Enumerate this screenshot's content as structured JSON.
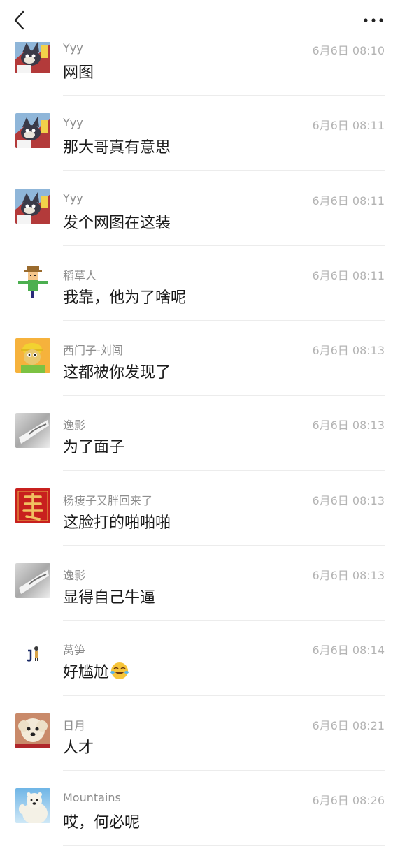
{
  "header": {
    "back_icon": "chevron-left-icon",
    "more_icon": "more-horizontal-icon"
  },
  "messages": [
    {
      "name": "Yyy",
      "time": "6月6日 08:10",
      "text": "网图",
      "avatar": "cat-avatar"
    },
    {
      "name": "Yyy",
      "time": "6月6日 08:11",
      "text": "那大哥真有意思",
      "avatar": "cat-avatar"
    },
    {
      "name": "Yyy",
      "time": "6月6日 08:11",
      "text": "发个网图在这装",
      "avatar": "cat-avatar"
    },
    {
      "name": "稻草人",
      "time": "6月6日 08:11",
      "text": "我靠，他为了啥呢",
      "avatar": "scarecrow-avatar"
    },
    {
      "name": "西门子-刘闯",
      "time": "6月6日 08:13",
      "text": "这都被你发现了",
      "avatar": "worker-avatar"
    },
    {
      "name": "逸影",
      "time": "6月6日 08:13",
      "text": "为了面子",
      "avatar": "hand-photo-avatar"
    },
    {
      "name": "杨瘦子又胖回来了",
      "time": "6月6日 08:13",
      "text": "这脸打的啪啪啪",
      "avatar": "red-seal-avatar"
    },
    {
      "name": "逸影",
      "time": "6月6日 08:13",
      "text": "显得自己牛逼",
      "avatar": "hand-photo-avatar"
    },
    {
      "name": "莴笋",
      "time": "6月6日 08:14",
      "text": "好尴尬",
      "avatar": "small-figure-avatar",
      "emoji": "laugh-cry-emoji"
    },
    {
      "name": "日月",
      "time": "6月6日 08:21",
      "text": "人才",
      "avatar": "dog-avatar"
    },
    {
      "name": "Mountains",
      "time": "6月6日 08:26",
      "text": "哎，何必呢",
      "avatar": "polar-bear-avatar"
    }
  ]
}
